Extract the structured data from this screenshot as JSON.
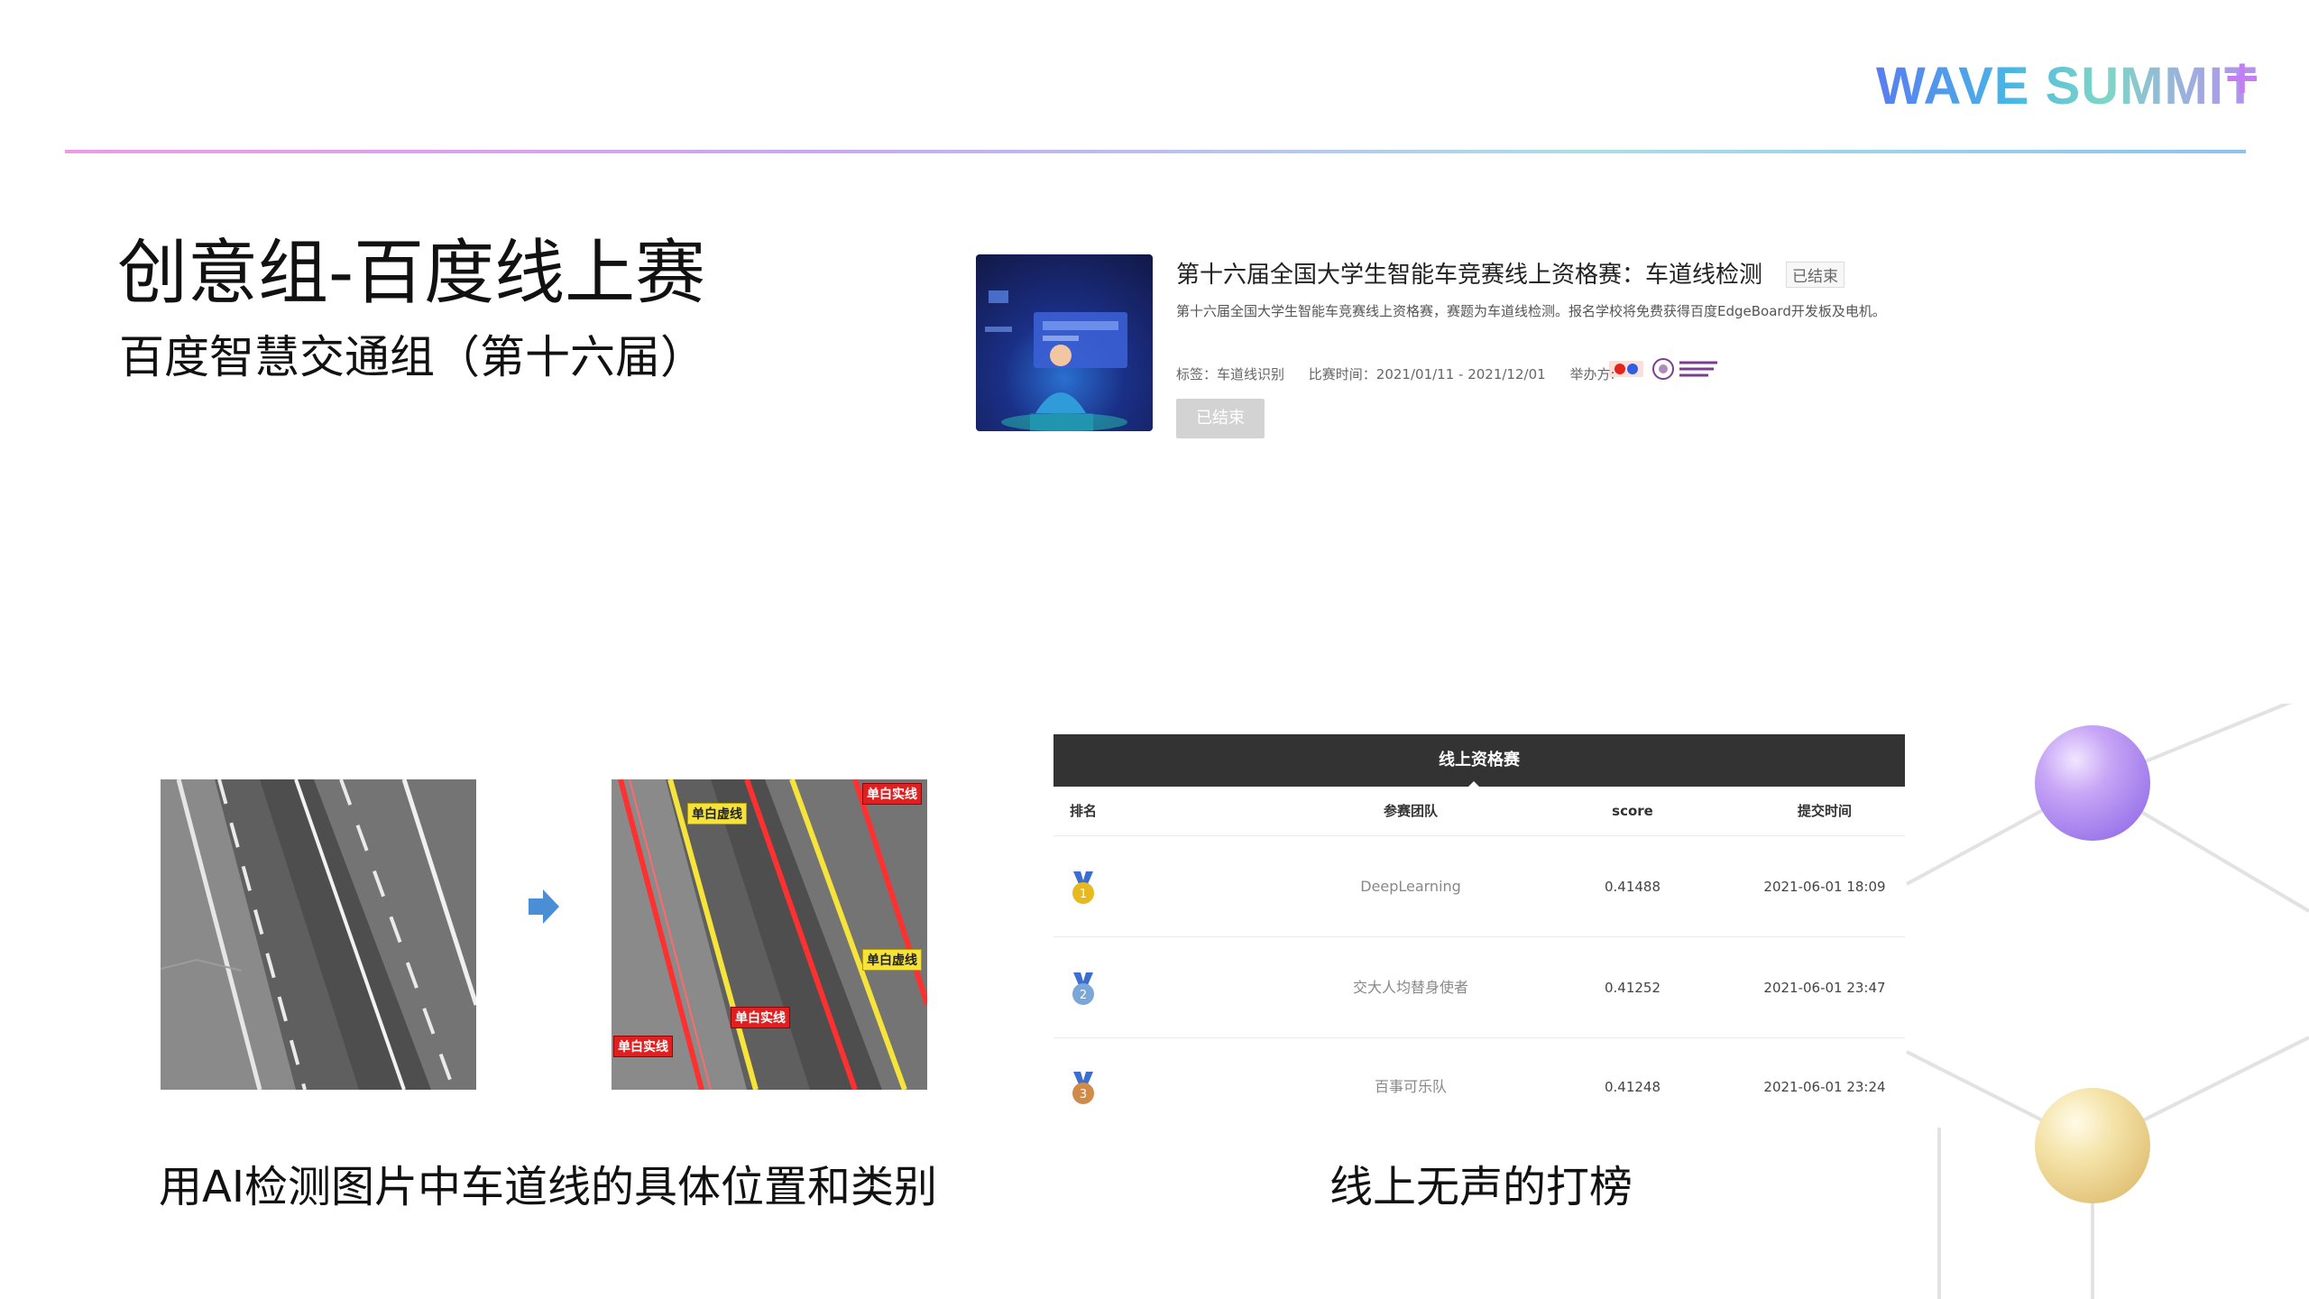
{
  "header": {
    "logo_text": "WAVE SUMMIT",
    "logo_plus": "+"
  },
  "slide": {
    "title": "创意组-百度线上赛",
    "subtitle": "百度智慧交通组（第十六届）"
  },
  "competition": {
    "title": "第十六届全国大学生智能车竞赛线上资格赛：车道线检测",
    "status_tag": "已结束",
    "description": "第十六届全国大学生智能车竞赛线上资格赛，赛题为车道线检测。报名学校将免费获得百度EdgeBoard开发板及电机。",
    "tags_label": "标签：车道线识别",
    "time_label": "比赛时间：2021/01/11 - 2021/12/01",
    "organizer_label": "举办方:",
    "button_label": "已结束"
  },
  "lane_labels": {
    "dashed_white": "单白虚线",
    "solid_white": "单白实线"
  },
  "leaderboard": {
    "tab_title": "线上资格赛",
    "columns": [
      "排名",
      "参赛团队",
      "score",
      "提交时间"
    ],
    "rows": [
      {
        "rank": "1",
        "team": "DeepLearning",
        "score": "0.41488",
        "time": "2021-06-01 18:09"
      },
      {
        "rank": "2",
        "team": "交大人均替身使者",
        "score": "0.41252",
        "time": "2021-06-01 23:47"
      },
      {
        "rank": "3",
        "team": "百事可乐队",
        "score": "0.41248",
        "time": "2021-06-01 23:24"
      }
    ]
  },
  "captions": {
    "left": "用AI检测图片中车道线的具体位置和类别",
    "right": "线上无声的打榜"
  },
  "colors": {
    "gold": "#e8b820",
    "silver": "#7aa6d8",
    "bronze": "#d08a4a",
    "header_dark": "#333333"
  }
}
